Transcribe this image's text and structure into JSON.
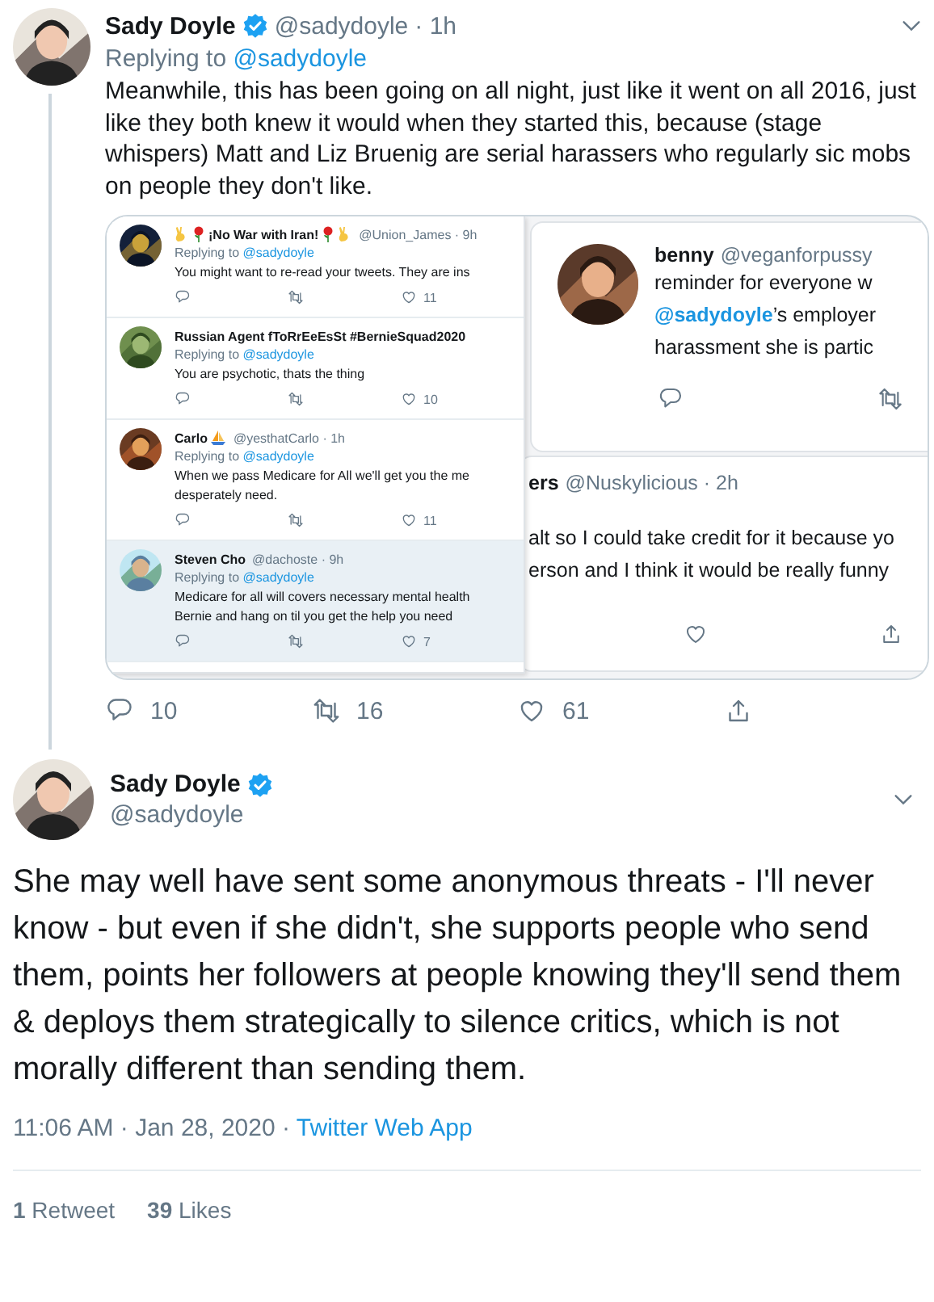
{
  "thread_reply": {
    "name": "Sady Doyle",
    "verified": true,
    "handle": "@sadydoyle",
    "time": "· 1h",
    "replying_label": "Replying to",
    "replying_to": "@sadydoyle",
    "text": "Meanwhile, this has been going on all night, just like it went on all 2016, just like they both knew it would when they started this, because (stage whispers) Matt and Liz Bruenig are serial harassers who regularly sic mobs on people they don't like.",
    "media": {
      "replies": [
        {
          "kind": "peace-roses",
          "name": "¡No War with Iran!",
          "handle": "@Union_James · 9h",
          "replying_label": "Replying to",
          "replying_to": "@sadydoyle",
          "lines": [
            "You might want to re-read your tweets. They are ins"
          ],
          "like_count": "11",
          "highlighted": false
        },
        {
          "kind": "plain",
          "name": "Russian Agent fToRrEeEsSt #BernieSquad2020",
          "replying_label": "Replying to",
          "replying_to": "@sadydoyle",
          "lines": [
            "You are psychotic, thats the thing"
          ],
          "like_count": "10",
          "highlighted": false
        },
        {
          "kind": "sailboat",
          "name": "Carlo",
          "handle": "@yesthatCarlo · 1h",
          "replying_label": "Replying to",
          "replying_to": "@sadydoyle",
          "lines": [
            "When we pass Medicare for All we'll get you the me",
            "desperately need."
          ],
          "like_count": "11",
          "highlighted": false
        },
        {
          "kind": "plain",
          "name": "Steven Cho",
          "handle": "@dachoste · 9h",
          "replying_label": "Replying to",
          "replying_to": "@sadydoyle",
          "lines": [
            "Medicare for all will covers necessary mental health",
            "Bernie and hang on til you get the help you need"
          ],
          "like_count": "7",
          "highlighted": true
        }
      ],
      "quoted": {
        "name": "benny",
        "handle": "@veganforpussy",
        "line_1": "reminder for everyone w",
        "mention": "@sadydoyle",
        "line_2_rest": "’s employer",
        "line_3": "harassment she is partic"
      },
      "behind": {
        "name": "ers",
        "handle": "@Nuskylicious · 2h",
        "lines": [
          "alt so I could take credit for it because yo",
          "erson and I think it would be really funny"
        ]
      }
    },
    "counts": {
      "reply": "10",
      "retweet": "16",
      "like": "61"
    }
  },
  "main_tweet": {
    "name": "Sady Doyle",
    "verified": true,
    "handle": "@sadydoyle",
    "text": "She may well have sent some anonymous threats - I'll never know - but even if she didn't, she supports people who send them, points her followers at people knowing they'll send them & deploys them strategically to silence critics, which is not morally different than sending them.",
    "time": "11:06 AM · Jan 28, 2020 ·",
    "source": "Twitter Web App",
    "stats": [
      "**1** Retweet",
      "**39** Likes"
    ]
  }
}
